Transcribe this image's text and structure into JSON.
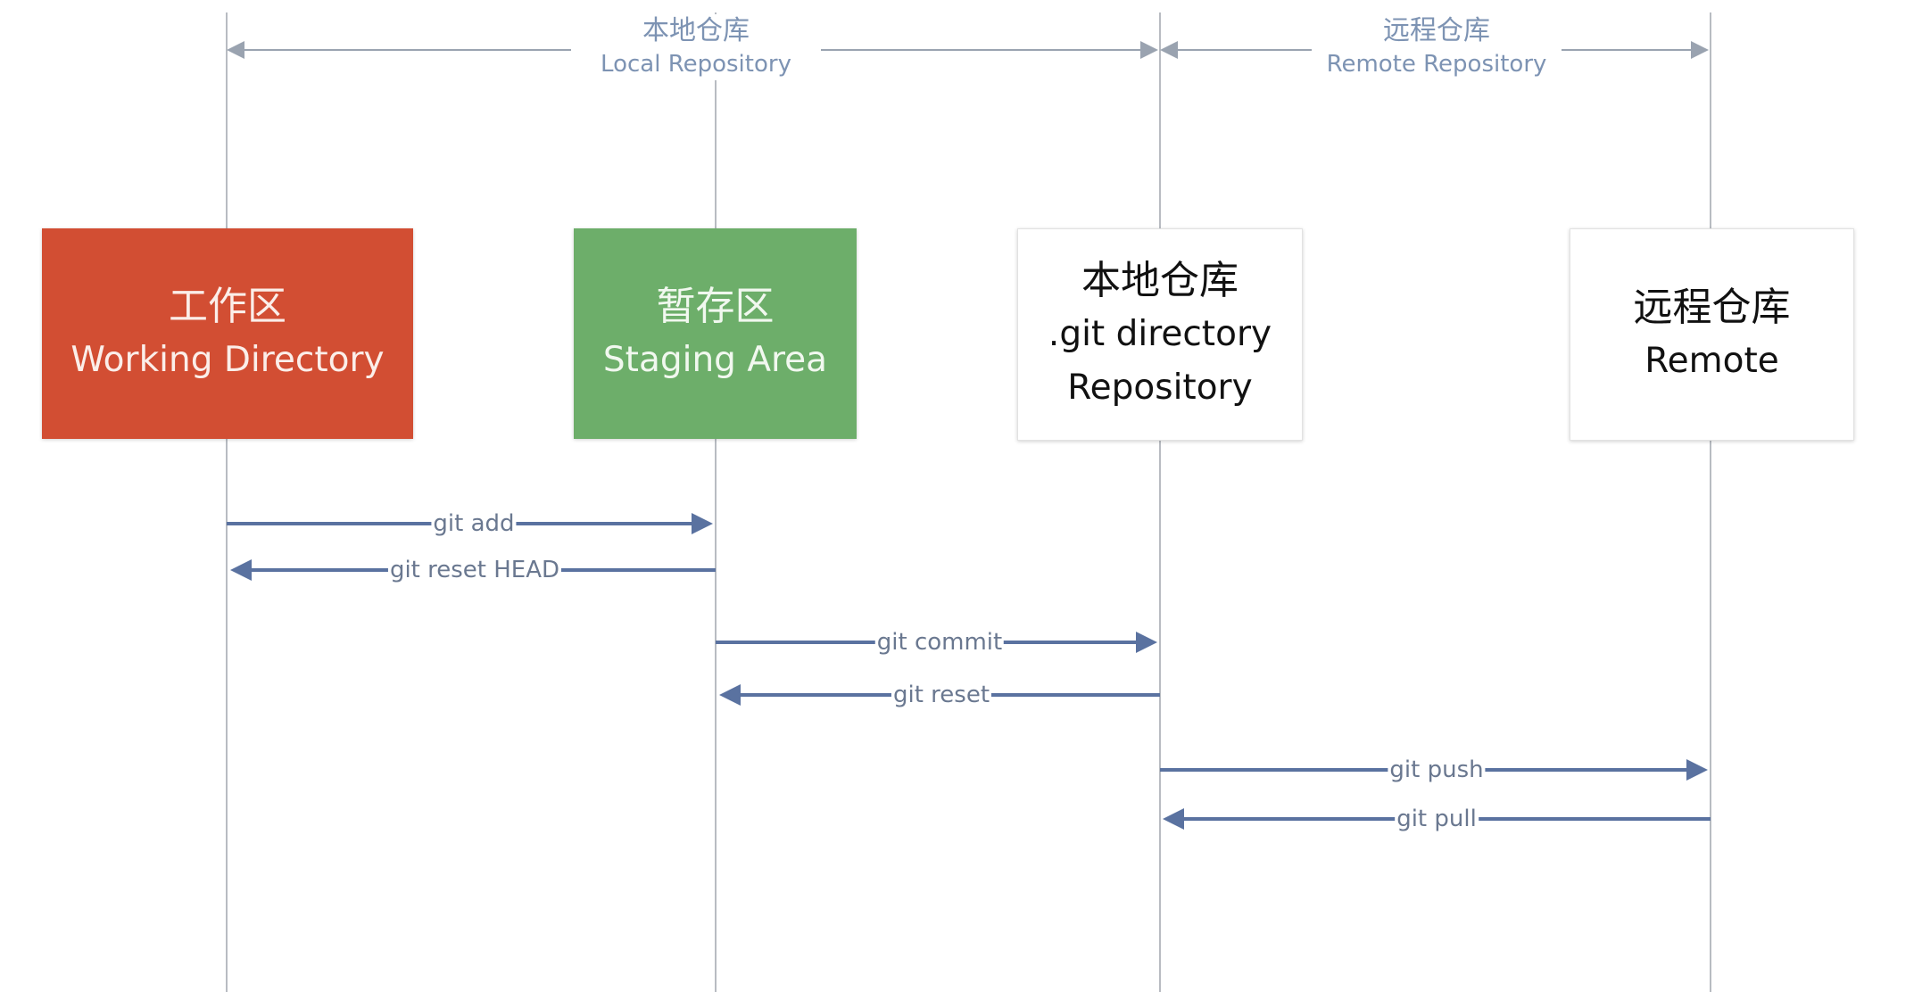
{
  "regions": [
    {
      "zh": "本地仓库",
      "en": "Local Repository"
    },
    {
      "zh": "远程仓库",
      "en": "Remote Repository"
    }
  ],
  "boxes": [
    {
      "zh": "工作区",
      "en": "Working Directory",
      "color": "#d24e33"
    },
    {
      "zh": "暂存区",
      "en": "Staging Area",
      "color": "#6dae6a"
    },
    {
      "zh": "本地仓库",
      "en": ".git directory",
      "en2": "Repository",
      "color": "#ffffff"
    },
    {
      "zh": "远程仓库",
      "en": "Remote",
      "color": "#ffffff"
    }
  ],
  "commands": [
    {
      "label": "git add",
      "from": "Working Directory",
      "to": "Staging Area"
    },
    {
      "label": "git reset HEAD",
      "from": "Staging Area",
      "to": "Working Directory"
    },
    {
      "label": "git commit",
      "from": "Staging Area",
      "to": "Repository"
    },
    {
      "label": "git reset",
      "from": "Repository",
      "to": "Staging Area"
    },
    {
      "label": "git push",
      "from": "Repository",
      "to": "Remote"
    },
    {
      "label": "git pull",
      "from": "Remote",
      "to": "Repository"
    }
  ],
  "colors": {
    "arrow": "#5a72a0",
    "line": "#b8bcc2"
  }
}
